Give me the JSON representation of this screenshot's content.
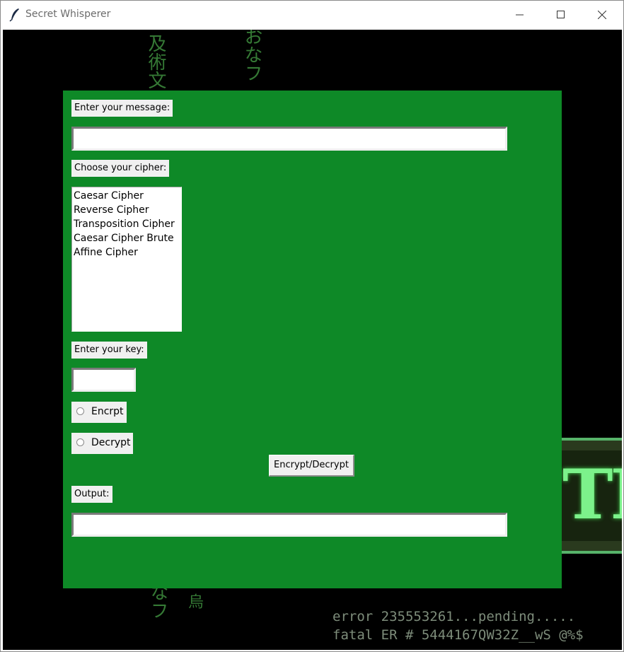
{
  "window": {
    "title": "Secret Whisperer",
    "app_icon": "feather-icon",
    "controls": {
      "minimize_icon": "minimize-icon",
      "maximize_icon": "maximize-icon",
      "close_icon": "close-icon"
    }
  },
  "background": {
    "glyph_column_1": "及術文",
    "glyph_column_2": "おなフ",
    "glyph_column_3": "なフ",
    "glyph_column_4": "烏",
    "banner_text": "TE",
    "console_line_1": "error 235553261...pending.....",
    "console_line_2": "fatal ER # 5444167QW32Z__wS @%$"
  },
  "form": {
    "message_label": "Enter your message:",
    "message_value": "",
    "cipher_label": "Choose your cipher:",
    "ciphers": [
      "Caesar Cipher",
      "Reverse Cipher",
      "Transposition Cipher",
      "Caesar Cipher Brute",
      "Affine Cipher"
    ],
    "key_label": "Enter your key:",
    "key_value": "",
    "encrypt_radio_label": "Encrpt",
    "decrypt_radio_label": "Decrypt",
    "mode_selected": "",
    "action_button_label": "Encrypt/Decrypt",
    "output_label": "Output:",
    "output_value": ""
  },
  "colors": {
    "panel": "#0e8927",
    "widget_bg": "#f0f0f0",
    "matrix_green": "#7cf28b",
    "background": "#000000"
  }
}
